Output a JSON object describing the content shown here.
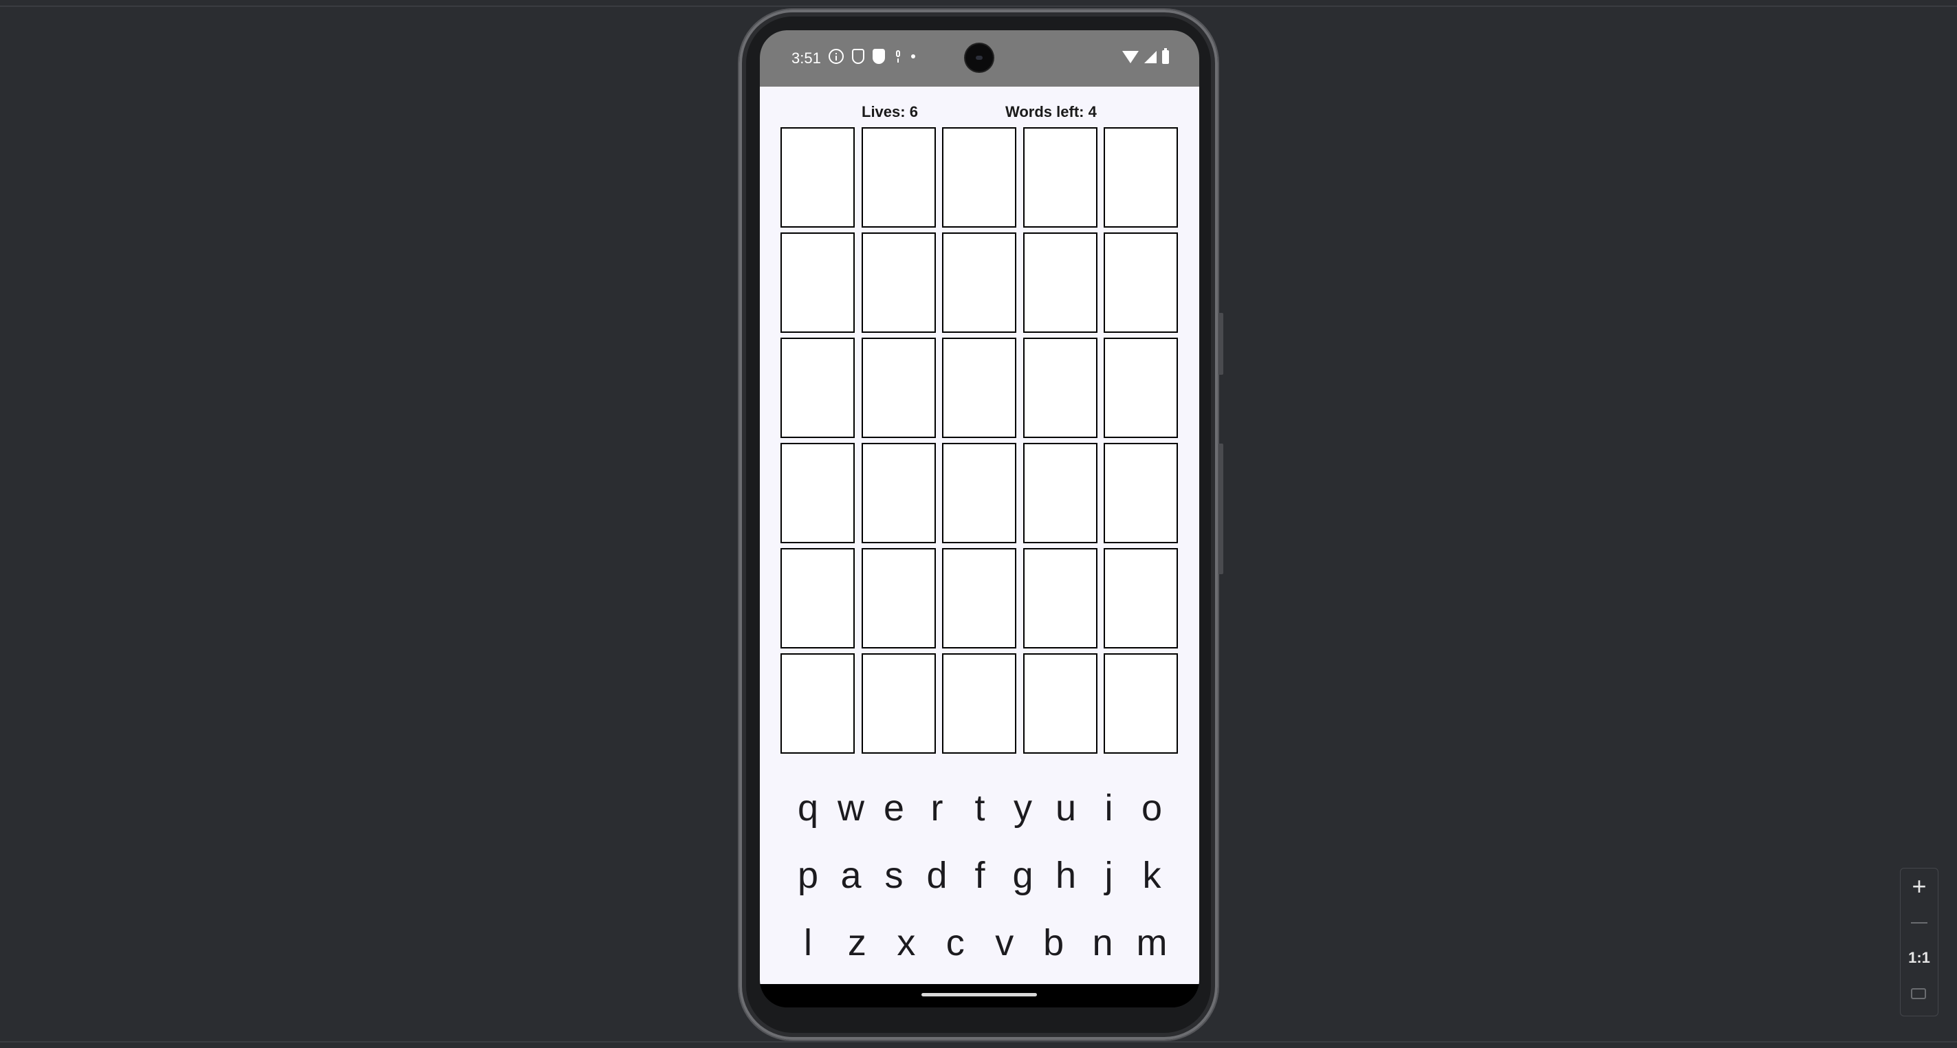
{
  "status_bar": {
    "time": "3:51",
    "left_icons": [
      "info-icon",
      "shield-icon",
      "shield-solid-icon",
      "mic-icon",
      "dot-icon"
    ],
    "right_icons": [
      "wifi-icon",
      "signal-icon",
      "battery-icon"
    ]
  },
  "game": {
    "lives_label": "Lives: 6",
    "words_left_label": "Words left: 4",
    "grid": {
      "rows": 6,
      "cols": 5
    }
  },
  "keyboard": {
    "rows": [
      [
        "q",
        "w",
        "e",
        "r",
        "t",
        "y",
        "u",
        "i",
        "o"
      ],
      [
        "p",
        "a",
        "s",
        "d",
        "f",
        "g",
        "h",
        "j",
        "k"
      ],
      [
        "l",
        "z",
        "x",
        "c",
        "v",
        "b",
        "n",
        "m"
      ]
    ]
  },
  "emulator": {
    "zoom_in": "+",
    "zoom_reset": "1:1"
  },
  "colors": {
    "app_background": "#f7f6fd",
    "status_bar": "#7a7a7a",
    "desktop_background": "#2b2d31",
    "cell_border": "#000000"
  }
}
